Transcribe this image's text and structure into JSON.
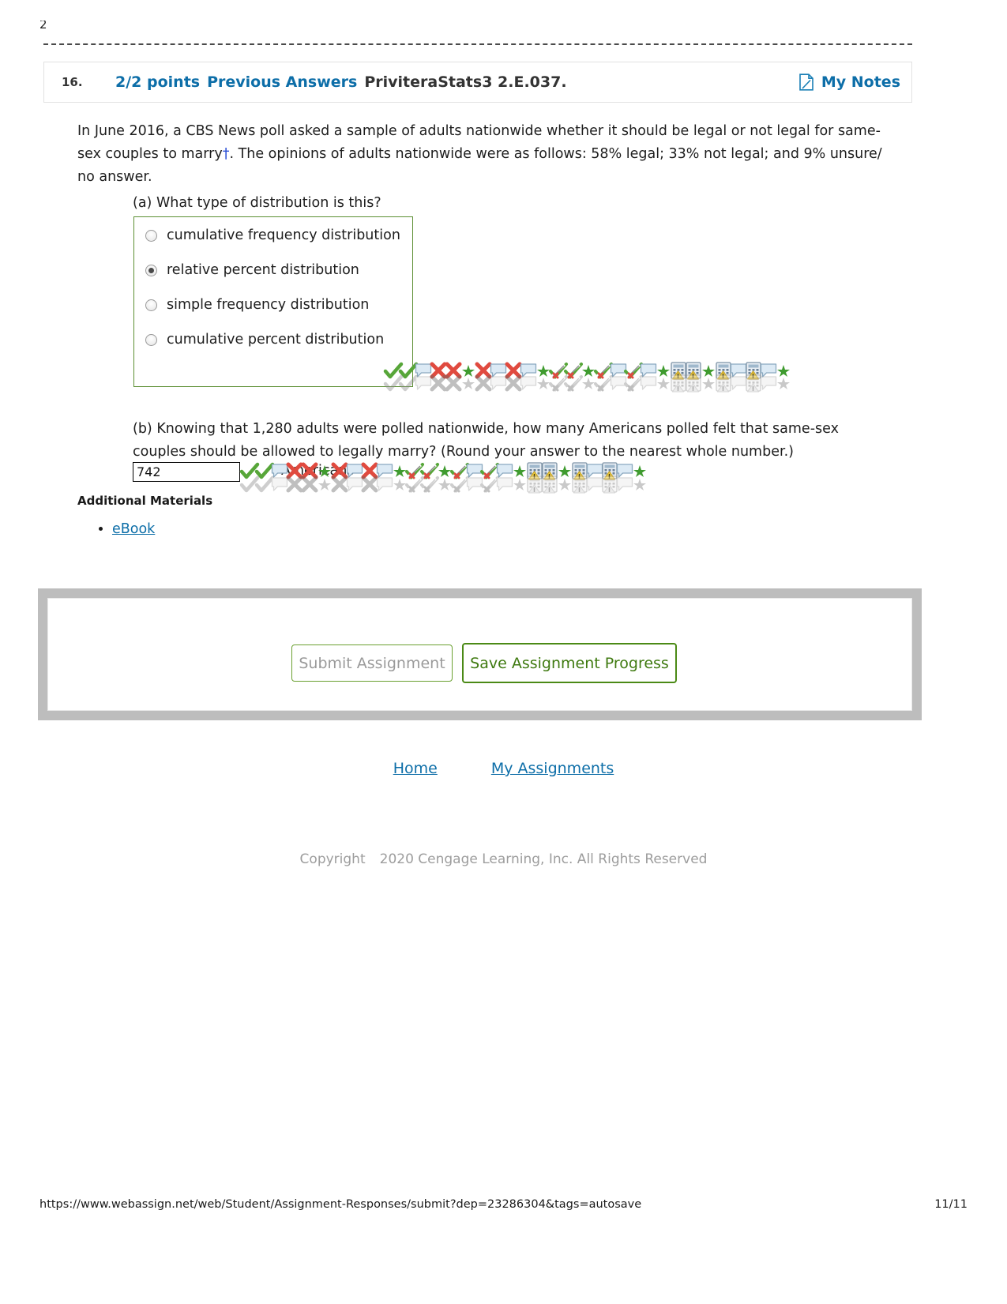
{
  "print": {
    "page_artifact": "2",
    "url": "https://www.webassign.net/web/Student/Assignment-Responses/submit?dep=23286304&tags=autosave",
    "page_indicator": "11/11"
  },
  "question_header": {
    "number": "16.",
    "points": "2/2 points",
    "previous_answers": "Previous Answers",
    "textbook_code": "PriviteraStats3 2.E.037.",
    "notes_label": "My Notes",
    "notes_icon": "note-page-icon",
    "accent_color": "#0d6ea8"
  },
  "question": {
    "prompt_line_1": "In June 2016, a CBS News poll asked a sample of adults nationwide whether it should be legal or not legal for same-",
    "prompt_line_2a": "sex couples to marry",
    "dagger": "†",
    "prompt_line_2b": ". The opinions of adults nationwide were as follows: 58% legal; 33% not legal; and 9%",
    "prompt_line_3": "unsure/ no answer."
  },
  "part_a": {
    "label": "(a) What type of distribution is this?",
    "border_color": "#5c8f33",
    "options": [
      {
        "label": "cumulative frequency distribution",
        "selected": false
      },
      {
        "label": "relative percent distribution",
        "selected": true
      },
      {
        "label": "simple frequency distribution",
        "selected": false
      },
      {
        "label": "cumulative percent distribution",
        "selected": false
      }
    ]
  },
  "part_b": {
    "line_1": "(b) Knowing that 1,280 adults were polled nationwide, how many Americans polled felt that same-sex",
    "line_2": "couples should be allowed to legally marry? (Round your answer to the nearest whole number.)",
    "answer_value": "742",
    "answer_unit_ghost": "Americans"
  },
  "additional_materials": {
    "heading": "Additional Materials",
    "links": [
      {
        "label": "eBook"
      }
    ]
  },
  "submit_panel": {
    "submit_label": "Submit Assignment",
    "save_label": "Save Assignment Progress",
    "submit_border_color": "#6aa030",
    "save_border_color": "#4b8a16",
    "panel_color": "#bdbdbd"
  },
  "footer": {
    "links": [
      {
        "label": "Home"
      },
      {
        "label": "My Assignments"
      }
    ],
    "copyright_word": "Copyright",
    "copyright_text": "2020 Cengage Learning, Inc. All Rights Reserved"
  },
  "icon_artifacts": {
    "description": "overlapping grading feedback icons",
    "row_a": [
      "check-icon",
      "check-icon",
      "speech-bubble-icon",
      "cross-icon",
      "cross-icon",
      "star-icon",
      "cross-icon",
      "speech-bubble-icon",
      "cross-icon",
      "speech-bubble-icon",
      "star-icon",
      "check-slash-icon",
      "check-slash-icon",
      "star-icon",
      "check-slash-icon",
      "speech-bubble-icon",
      "check-slash-icon",
      "speech-bubble-icon",
      "star-icon",
      "calculator-icon",
      "calculator-icon",
      "star-icon",
      "calculator-icon",
      "speech-bubble-icon",
      "calculator-icon",
      "speech-bubble-icon",
      "star-icon"
    ],
    "row_b": [
      "check-icon",
      "check-icon",
      "speech-bubble-icon",
      "cross-icon",
      "cross-icon",
      "star-icon",
      "cross-icon",
      "speech-bubble-icon",
      "cross-icon",
      "speech-bubble-icon",
      "star-icon",
      "check-slash-icon",
      "check-slash-icon",
      "star-icon",
      "check-slash-icon",
      "speech-bubble-icon",
      "check-slash-icon",
      "speech-bubble-icon",
      "star-icon",
      "calculator-icon",
      "calculator-icon",
      "star-icon",
      "calculator-icon",
      "speech-bubble-icon",
      "calculator-icon",
      "speech-bubble-icon",
      "star-icon"
    ]
  }
}
